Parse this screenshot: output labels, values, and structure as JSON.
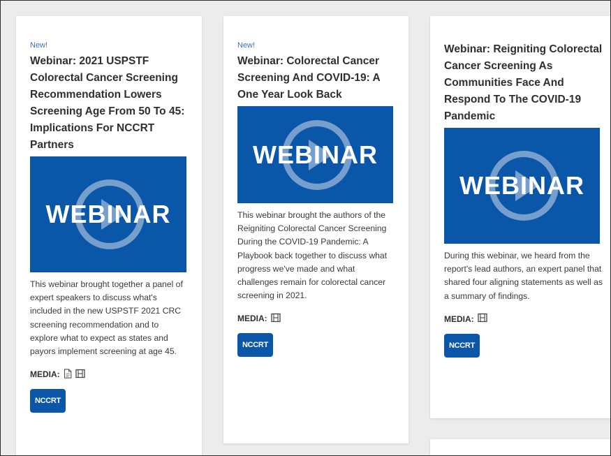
{
  "cards": [
    {
      "new_label": "New!",
      "title": "Webinar: 2021 USPSTF Colorectal Cancer Screening Recommendation Lowers Screening Age From 50 To 45: Implications For NCCRT Partners",
      "thumbnail_text": "WEBINAR",
      "description": "This webinar brought together a panel of expert speakers to discuss what's included in the new USPSTF 2021 CRC screening recommendation and to explore what to expect as states and payors implement screening at age 45.",
      "media_label": "MEDIA:",
      "media_icons": [
        "document-icon",
        "film-icon"
      ],
      "tag": "NCCRT"
    },
    {
      "new_label": "New!",
      "title": "Webinar: Colorectal Cancer Screening And COVID-19: A One Year Look Back",
      "thumbnail_text": "WEBINAR",
      "description": "This webinar brought the authors of the Reigniting Colorectal Cancer Screening During the COVID-19 Pandemic: A Playbook back together to discuss what progress we've made and what challenges remain for colorectal cancer screening in 2021.",
      "media_label": "MEDIA:",
      "media_icons": [
        "film-icon"
      ],
      "tag": "NCCRT"
    },
    {
      "title": "Webinar: Reigniting Colorectal Cancer Screening As Communities Face And Respond To The COVID-19 Pandemic",
      "thumbnail_text": "WEBINAR",
      "description": "During this webinar, we heard from the report's lead authors, an expert panel that shared four aligning statements as well as a summary of findings.",
      "media_label": "MEDIA:",
      "media_icons": [
        "film-icon"
      ],
      "tag": "NCCRT"
    }
  ],
  "colors": {
    "brand_blue": "#0a56a8",
    "new_label": "#3d74b8",
    "page_bg": "#ececec"
  }
}
